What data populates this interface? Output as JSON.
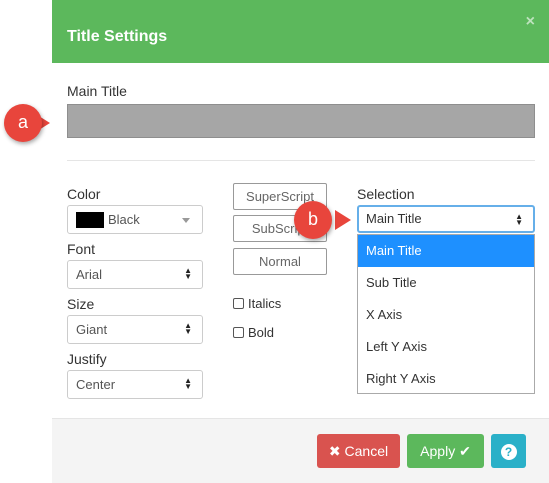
{
  "header": {
    "title": "Title Settings",
    "close_glyph": "×"
  },
  "main_title": {
    "label": "Main Title",
    "value": ""
  },
  "color": {
    "label": "Color",
    "value": "Black",
    "swatch_color": "#000000"
  },
  "font": {
    "label": "Font",
    "value": "Arial"
  },
  "size": {
    "label": "Size",
    "value": "Giant"
  },
  "justify": {
    "label": "Justify",
    "value": "Center"
  },
  "script_buttons": {
    "superscript": "SuperScript",
    "subscript": "SubScript",
    "normal": "Normal"
  },
  "checkboxes": {
    "italics": "Italics",
    "bold": "Bold"
  },
  "selection": {
    "label": "Selection",
    "value": "Main Title",
    "options": [
      "Main Title",
      "Sub Title",
      "X Axis",
      "Left Y Axis",
      "Right Y Axis"
    ],
    "highlighted_index": 0
  },
  "footer": {
    "cancel_label": "Cancel",
    "apply_label": "Apply",
    "help_glyph": "?"
  },
  "callouts": {
    "a": "a",
    "b": "b"
  },
  "colors": {
    "header": "#5cb85c",
    "cancel": "#d9534f",
    "apply": "#5cb85c",
    "help": "#2ab0c8",
    "callout": "#e8453c",
    "highlight": "#1e90ff"
  }
}
